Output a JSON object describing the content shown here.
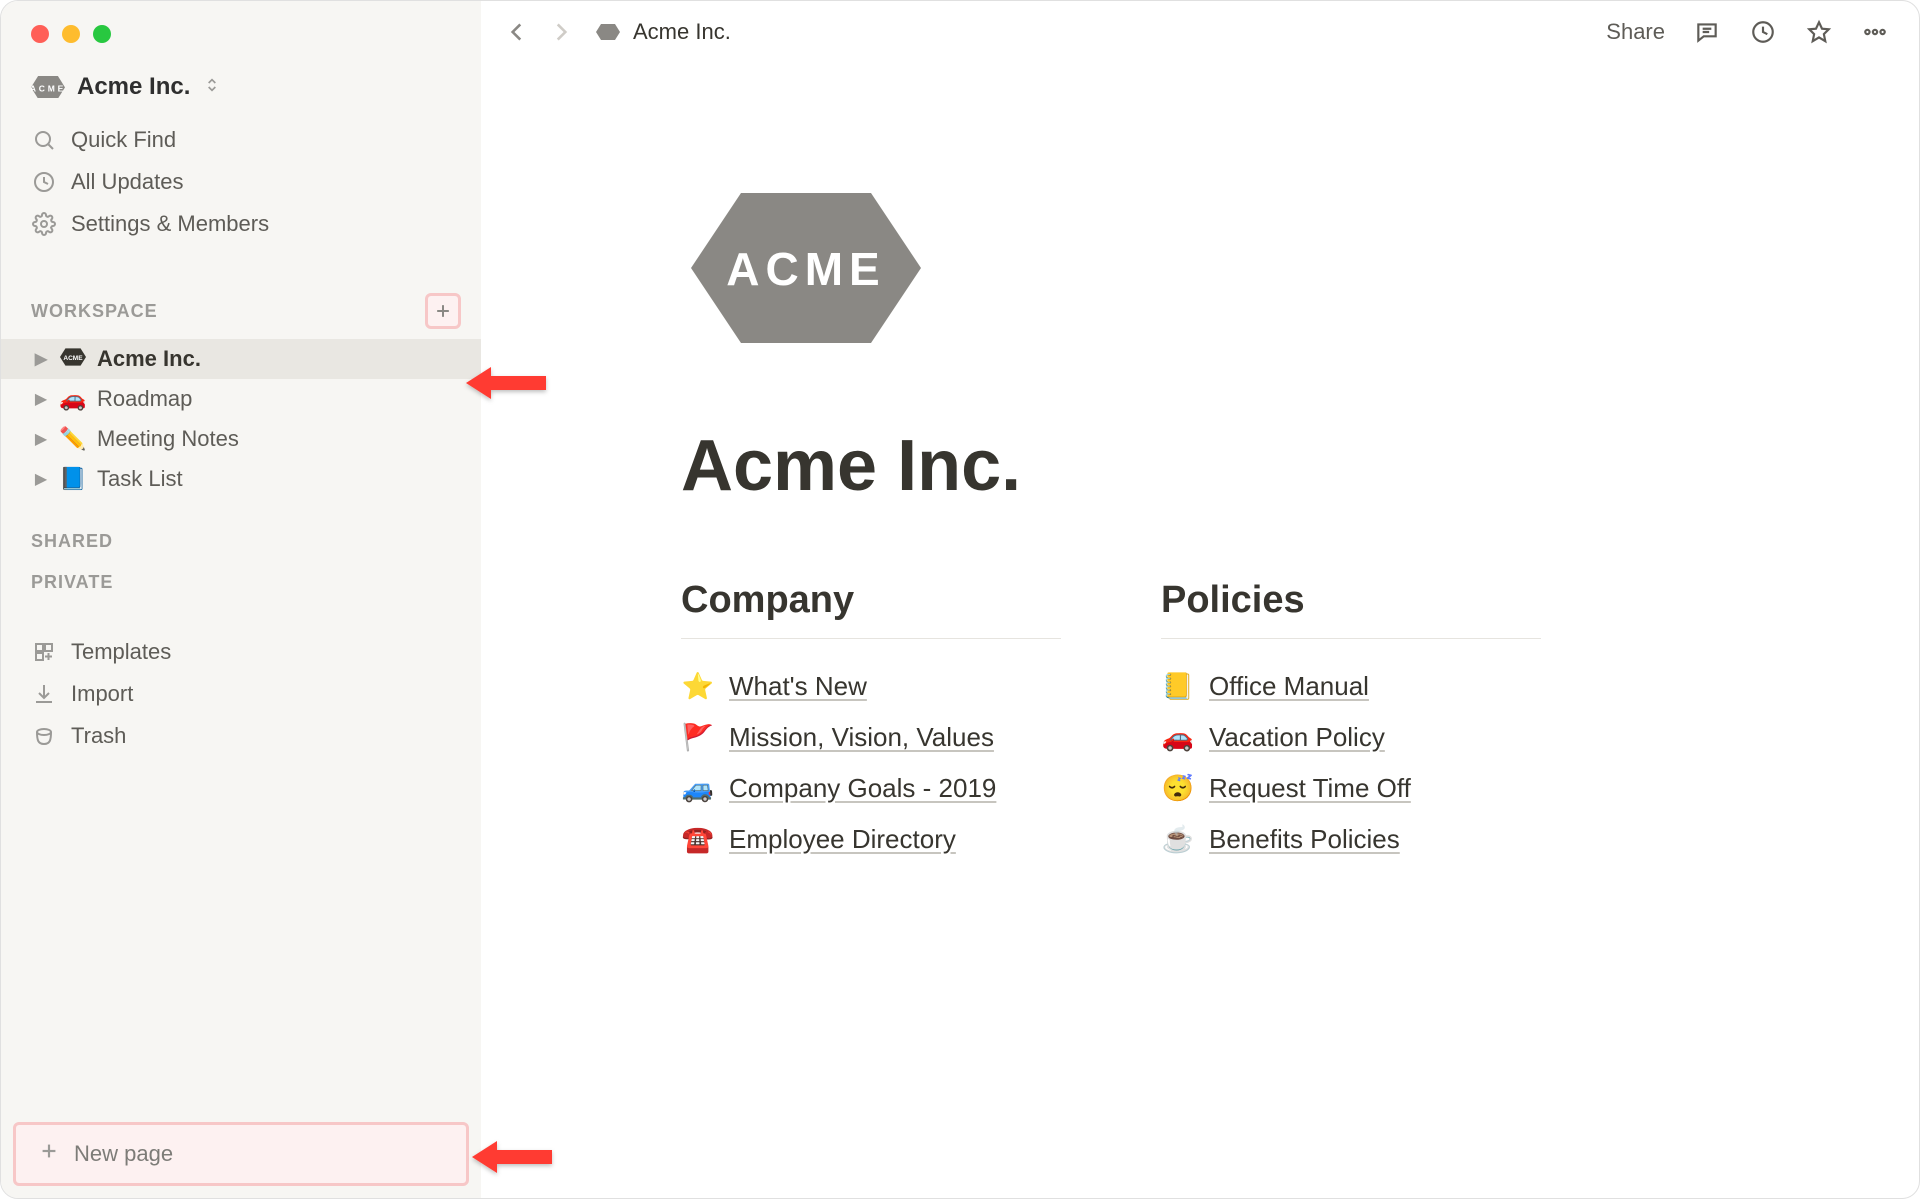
{
  "workspace": {
    "name": "Acme Inc."
  },
  "sidebar": {
    "quick_find": "Quick Find",
    "all_updates": "All Updates",
    "settings_members": "Settings & Members",
    "sections": {
      "workspace": "WORKSPACE",
      "shared": "SHARED",
      "private": "PRIVATE"
    },
    "pages": [
      {
        "icon": "acme-badge",
        "label": "Acme Inc.",
        "active": true
      },
      {
        "icon": "🚗",
        "label": "Roadmap",
        "active": false
      },
      {
        "icon": "✏️",
        "label": "Meeting Notes",
        "active": false
      },
      {
        "icon": "📘",
        "label": "Task List",
        "active": false
      }
    ],
    "templates": "Templates",
    "import": "Import",
    "trash": "Trash",
    "new_page": "New page"
  },
  "topbar": {
    "breadcrumb": "Acme Inc.",
    "share": "Share"
  },
  "page": {
    "logo_text": "ACME",
    "title": "Acme Inc.",
    "columns": [
      {
        "heading": "Company",
        "links": [
          {
            "emoji": "⭐",
            "label": "What's New"
          },
          {
            "emoji": "🚩",
            "label": "Mission, Vision, Values"
          },
          {
            "emoji": "🚙",
            "label": "Company Goals - 2019"
          },
          {
            "emoji": "☎️",
            "label": "Employee Directory"
          }
        ]
      },
      {
        "heading": "Policies",
        "links": [
          {
            "emoji": "📒",
            "label": "Office Manual"
          },
          {
            "emoji": "🚗",
            "label": "Vacation Policy"
          },
          {
            "emoji": "😴",
            "label": "Request Time Off"
          },
          {
            "emoji": "☕",
            "label": "Benefits Policies"
          }
        ]
      }
    ]
  }
}
